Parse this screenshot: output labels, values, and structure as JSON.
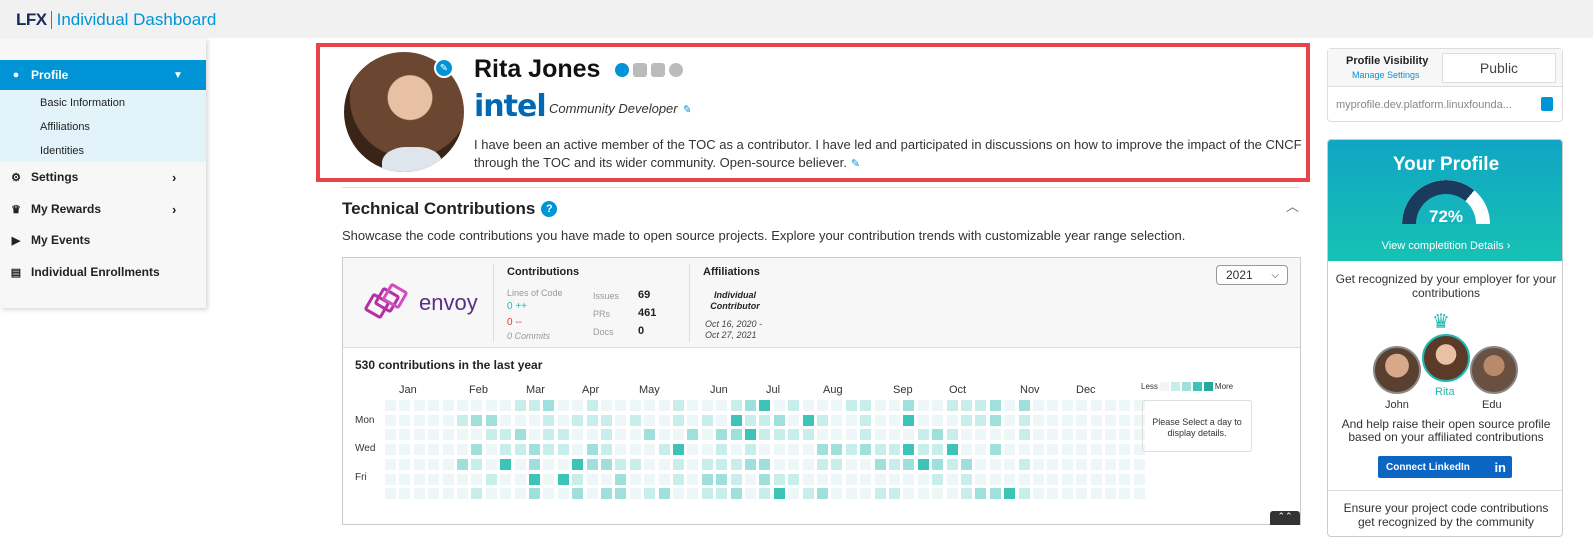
{
  "header": {
    "logo_text": "LFX",
    "app_title": "Individual Dashboard"
  },
  "sidebar": {
    "active": "Profile",
    "subitems": [
      "Basic Information",
      "Affiliations",
      "Identities"
    ],
    "items": [
      "Settings",
      "My Rewards",
      "My Events",
      "Individual Enrollments"
    ]
  },
  "profile": {
    "name": "Rita Jones",
    "company": "intel",
    "role": "Community Developer",
    "bio": "I have been an active member of the TOC as a contributor. I have led and participated in discussions on how to improve the impact of the CNCF through the TOC and its wider community. Open-source believer.",
    "socials": [
      "github-icon",
      "linkedin-icon",
      "twitter-icon",
      "facebook-icon"
    ]
  },
  "tech": {
    "title": "Technical Contributions",
    "description": "Showcase the code contributions you have made to open source projects. Explore your contribution trends with customizable year range selection.",
    "project": "envoy",
    "contributions_heading": "Contributions",
    "loc_label": "Lines of Code",
    "loc_added": "0 ++",
    "loc_removed": "0 --",
    "commits": "0 Commits",
    "issues_label": "Issues",
    "issues": "69",
    "prs_label": "PRs",
    "prs": "461",
    "docs_label": "Docs",
    "docs": "0",
    "affiliations_heading": "Affiliations",
    "affiliation": "Individual Contributor",
    "affiliation_dates": "Oct 16, 2020 - Oct 27, 2021",
    "year": "2021",
    "heatmap_title": "530 contributions in the last year",
    "months": [
      "Jan",
      "Feb",
      "Mar",
      "Apr",
      "May",
      "Jun",
      "Jul",
      "Aug",
      "Sep",
      "Oct",
      "Nov",
      "Dec"
    ],
    "days": [
      "Mon",
      "Wed",
      "Fri"
    ],
    "legend_less": "Less",
    "legend_more": "More",
    "detail_hint": "Please Select a day to display details.",
    "colors": [
      "#eef7f7",
      "#c8eeec",
      "#9fe0dc",
      "#3cc4b8"
    ]
  },
  "visibility": {
    "label": "Profile Visibility",
    "manage": "Manage Settings",
    "value": "Public",
    "url": "myprofile.dev.platform.linuxfounda..."
  },
  "your_profile": {
    "title": "Your Profile",
    "percent": "72%",
    "link": "View completition Details ›",
    "text1": "Get recognized by your employer for your contributions",
    "people": [
      "John",
      "Rita",
      "Edu"
    ],
    "text2": "And help raise their open source profile based on your affiliated contributions",
    "linkedin_button": "Connect LinkedIn",
    "text3": "Ensure your project code contributions get recognized by the community"
  }
}
